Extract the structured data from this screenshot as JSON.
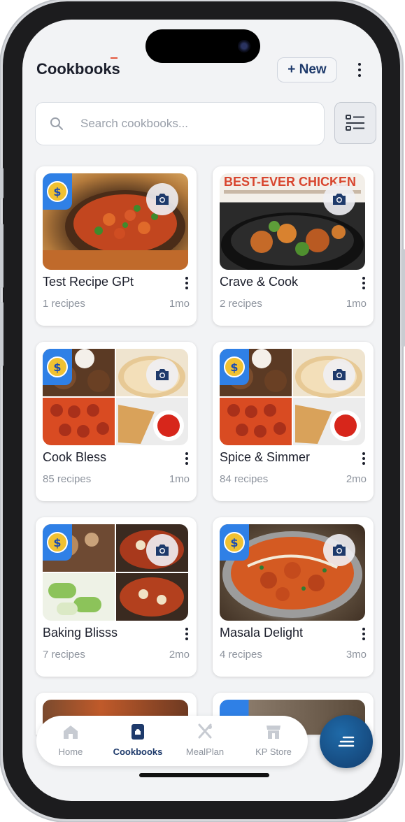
{
  "header": {
    "title": "Cookbooks",
    "new_button": "+ New"
  },
  "search": {
    "placeholder": "Search cookbooks..."
  },
  "cookbooks": [
    {
      "name": "Test Recipe GPt",
      "count": "1 recipes",
      "age": "1mo",
      "premium": true
    },
    {
      "name": "Crave & Cook",
      "count": "2 recipes",
      "age": "1mo",
      "premium": false,
      "cover_text": "BEST-EVER CHICKEN"
    },
    {
      "name": "Cook Bless",
      "count": "85 recipes",
      "age": "1mo",
      "premium": true
    },
    {
      "name": "Spice & Simmer",
      "count": "84 recipes",
      "age": "2mo",
      "premium": true
    },
    {
      "name": "Baking Blisss",
      "count": "7 recipes",
      "age": "2mo",
      "premium": true
    },
    {
      "name": "Masala Delight",
      "count": "4 recipes",
      "age": "3mo",
      "premium": true
    }
  ],
  "nav": [
    {
      "label": "Home",
      "icon": "home-icon"
    },
    {
      "label": "Cookbooks",
      "icon": "cookbook-icon",
      "active": true
    },
    {
      "label": "MealPlan",
      "icon": "utensils-icon"
    },
    {
      "label": "KP Store",
      "icon": "store-icon"
    }
  ],
  "fab": {
    "icon": "menu-lines-icon"
  },
  "colors": {
    "accent": "#1e3a6b",
    "badge": "#2f80e6",
    "fab": "#174f8a"
  }
}
